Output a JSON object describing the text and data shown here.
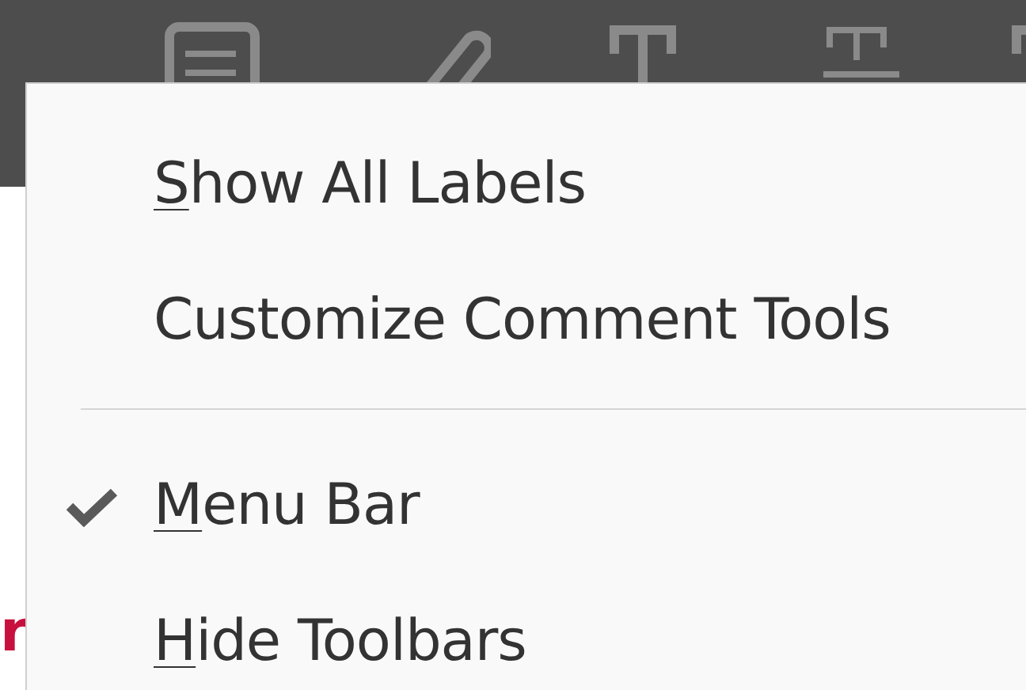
{
  "toolbar": {
    "tools": [
      {
        "kind": "note"
      },
      {
        "kind": "pencil"
      },
      {
        "kind": "text"
      },
      {
        "kind": "underline-text"
      },
      {
        "kind": "text-partial"
      }
    ]
  },
  "page": {
    "fragment": "r"
  },
  "menu": {
    "items": [
      {
        "kind": "item",
        "label": "Show All Labels",
        "access_key_underlined": true,
        "checked": false
      },
      {
        "kind": "item",
        "label": "Customize Comment Tools",
        "access_key_underlined": false,
        "checked": false
      },
      {
        "kind": "separator"
      },
      {
        "kind": "item",
        "label": "Menu Bar",
        "access_key_underlined": true,
        "checked": true
      },
      {
        "kind": "item",
        "label": "Hide Toolbars",
        "access_key_underlined": true,
        "checked": false
      }
    ]
  }
}
